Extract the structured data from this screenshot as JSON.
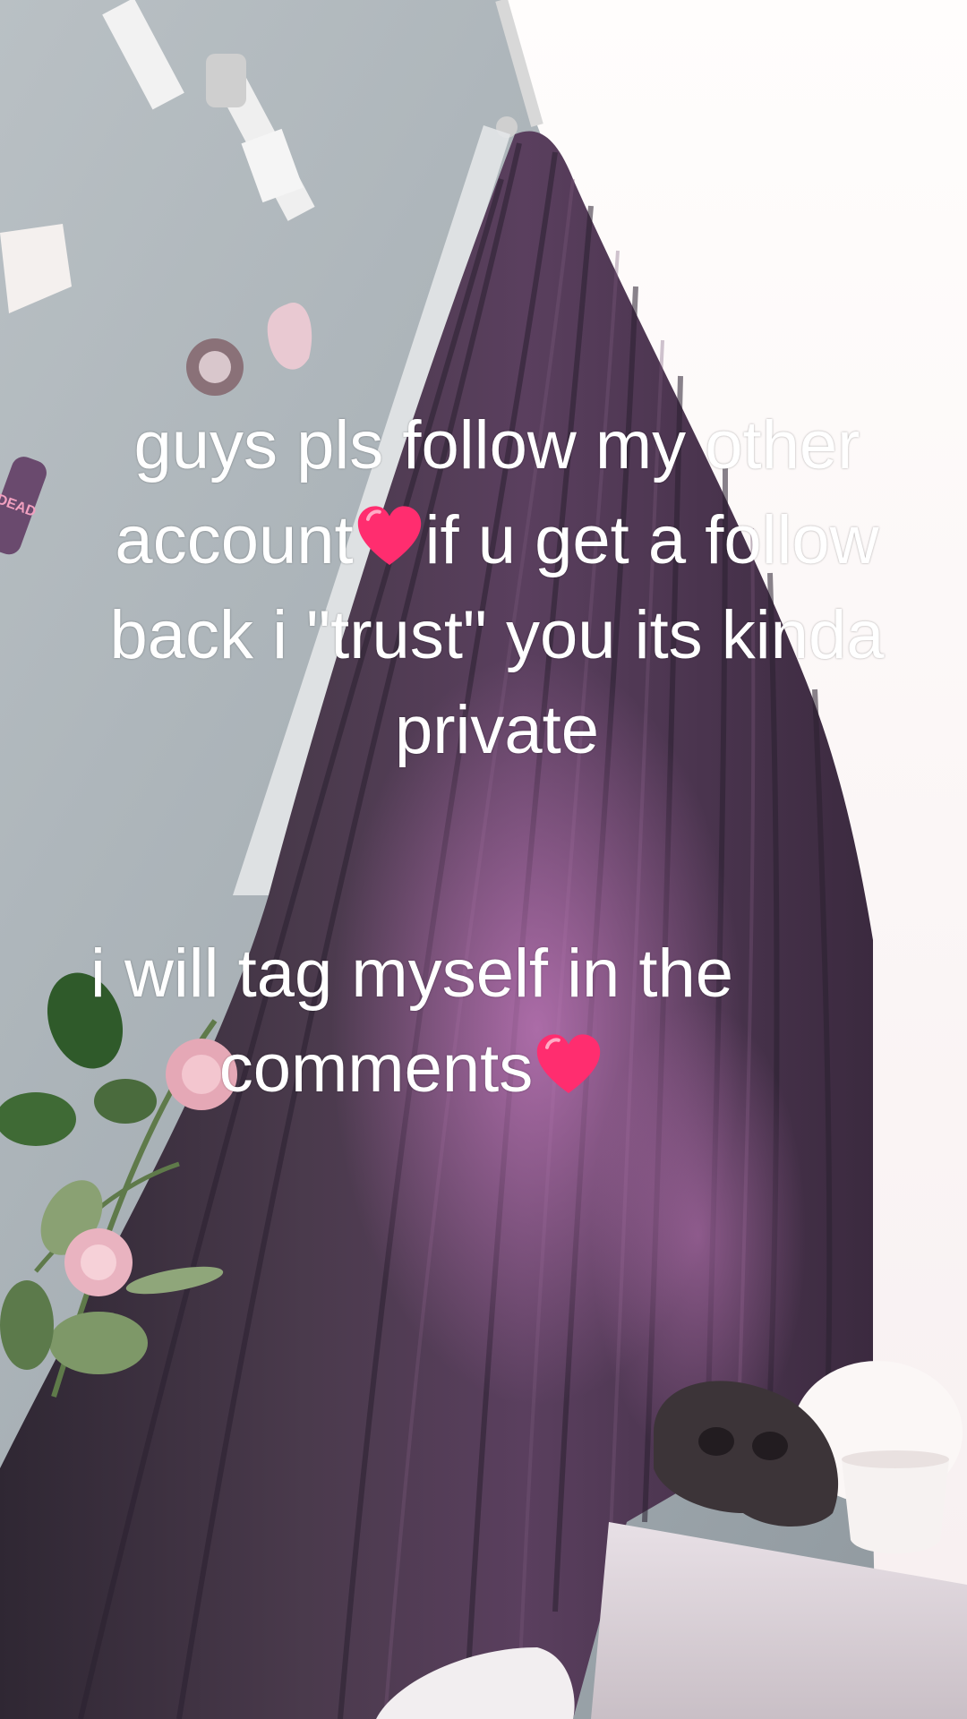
{
  "caption": {
    "line1": "guys pls follow my other",
    "line2_pre": "account",
    "line2_post": "if u get a follow",
    "line3": "back i \"trust\" you its kinda",
    "line4": "private",
    "line5": "i will tag myself in the",
    "line6_pre": "comments"
  },
  "colors": {
    "caption_text": "#ffffff",
    "heart": "#ff2d6f",
    "curtain": "#3a2a3e",
    "wall": "#a7b0b6",
    "window_light": "#fbf6f4"
  },
  "icons": {
    "heart": "red-heart-emoji-icon"
  },
  "sticker_text": {
    "warning_label": "DEAD"
  }
}
